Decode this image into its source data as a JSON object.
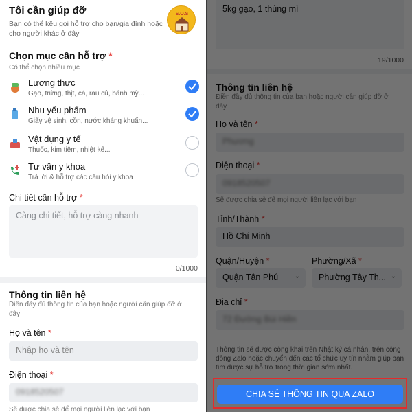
{
  "left": {
    "title": "Tôi cần giúp đỡ",
    "subtitle": "Bạn có thể kêu gọi hỗ trợ cho bạn/gia đình hoặc cho người khác ở đây",
    "sos_badge": "S.O.S",
    "support": {
      "title": "Chọn mục cần hỗ trợ",
      "required_mark": "*",
      "hint": "Có thể chọn nhiều mục",
      "categories": [
        {
          "icon": "food-icon",
          "label": "Lương thực",
          "desc": "Gạo, trứng, thịt, cá, rau củ, bánh mỳ...",
          "checked": true
        },
        {
          "icon": "supplies-icon",
          "label": "Nhu yếu phẩm",
          "desc": "Giấy vệ sinh, cồn, nước kháng khuẩn...",
          "checked": true
        },
        {
          "icon": "medical-supplies-icon",
          "label": "Vật dụng y tế",
          "desc": "Thuốc, kim tiêm, nhiệt kế...",
          "checked": false
        },
        {
          "icon": "medical-consult-icon",
          "label": "Tư vấn y khoa",
          "desc": "Trả lời & hỗ trợ các câu hỏi y khoa",
          "checked": false
        }
      ]
    },
    "details": {
      "label": "Chi tiết cần hỗ trợ",
      "required_mark": "*",
      "placeholder": "Càng chi tiết, hỗ trợ càng nhanh",
      "counter": "0/1000"
    },
    "contact": {
      "title": "Thông tin liên hệ",
      "hint": "Điền đầy đủ thông tin của bạn hoặc người cần giúp đỡ ở đây",
      "name_label": "Họ và tên",
      "name_placeholder": "Nhập họ và tên",
      "phone_label": "Điện thoại",
      "phone_value": "0918520507",
      "phone_hint": "Sẽ được chia sẻ để mọi người liên lạc với bạn",
      "required_mark": "*"
    }
  },
  "right": {
    "details_value": "5kg gạo, 1 thùng mì",
    "counter": "19/1000",
    "contact": {
      "title": "Thông tin liên hệ",
      "hint": "Điền đầy đủ thông tin của bạn hoặc người cần giúp đỡ ở đây",
      "name_label": "Họ và tên",
      "name_value": "Phương",
      "phone_label": "Điện thoại",
      "phone_value": "0918520507",
      "phone_hint": "Sẽ được chia sẻ để mọi người liên lạc với bạn",
      "province_label": "Tỉnh/Thành",
      "province_value": "Hồ Chí Minh",
      "district_label": "Quận/Huyện",
      "district_value": "Quận Tân Phú",
      "ward_label": "Phường/Xã",
      "ward_value": "Phường Tây Th...",
      "address_label": "Địa chỉ",
      "address_value": "72 Đường Bùi Hiền",
      "required_mark": "*"
    },
    "footer_note": "Thông tin sẽ được công khai trên Nhật ký cá nhân, trên cộng đồng Zalo hoặc chuyển đến các tổ chức uy tín nhằm giúp bạn tìm được sự hỗ trợ trong thời gian sớm nhất.",
    "share_button": "CHIA SẺ THÔNG TIN QUA ZALO"
  },
  "colors": {
    "accent": "#2f7df6",
    "highlight": "#e32b2b",
    "required": "#e53935"
  }
}
